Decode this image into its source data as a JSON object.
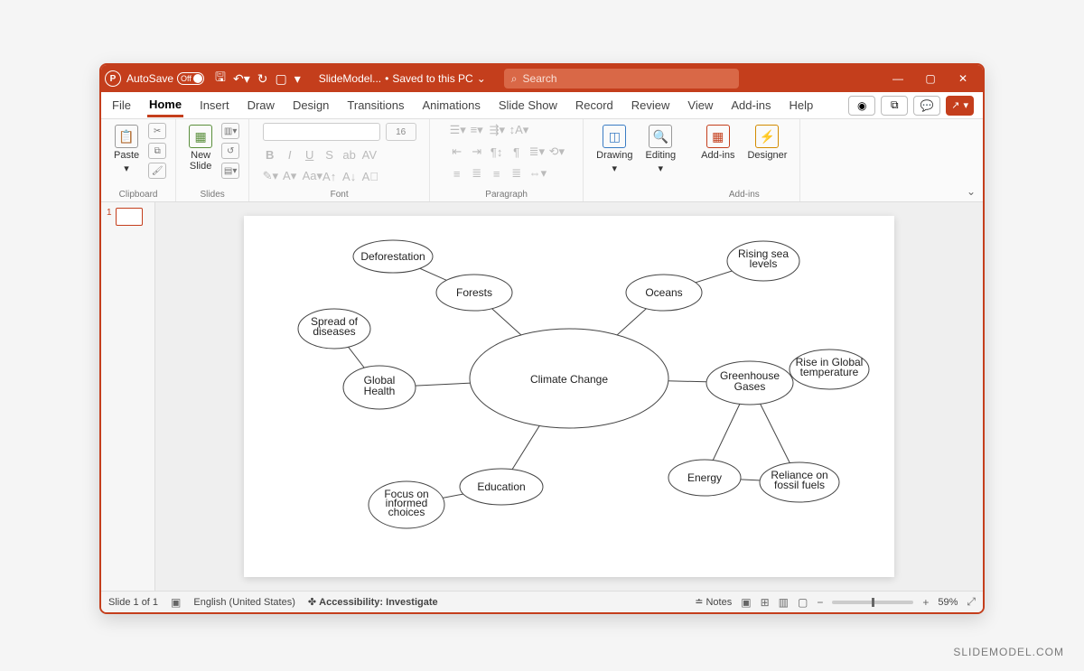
{
  "titlebar": {
    "autosave_label": "AutoSave",
    "autosave_state": "Off",
    "doc_name": "SlideModel...",
    "save_status": "Saved to this PC",
    "search_placeholder": "Search"
  },
  "menu": {
    "tabs": [
      "File",
      "Home",
      "Insert",
      "Draw",
      "Design",
      "Transitions",
      "Animations",
      "Slide Show",
      "Record",
      "Review",
      "View",
      "Add-ins",
      "Help"
    ],
    "active_index": 1
  },
  "ribbon": {
    "clipboard": {
      "paste": "Paste",
      "label": "Clipboard"
    },
    "slides": {
      "new_slide": "New\nSlide",
      "label": "Slides"
    },
    "font": {
      "size": "16",
      "label": "Font",
      "bold": "B",
      "italic": "I",
      "underline": "U",
      "strike": "S",
      "char_spacing": "AV"
    },
    "paragraph": {
      "label": "Paragraph"
    },
    "drawing": {
      "drawing": "Drawing",
      "editing": "Editing"
    },
    "addins": {
      "addins": "Add-ins",
      "designer": "Designer",
      "label": "Add-ins"
    }
  },
  "thumbnails": {
    "slide1_num": "1"
  },
  "mindmap": {
    "center": "Climate Change",
    "nodes": {
      "forests": "Forests",
      "deforestation": "Deforestation",
      "oceans": "Oceans",
      "rising_sea": "Rising sea\nlevels",
      "greenhouse": "Greenhouse\nGases",
      "rise_temp": "Rise in Global\ntemperature",
      "energy": "Energy",
      "fossil": "Reliance on\nfossil fuels",
      "education": "Education",
      "choices": "Focus on\ninformed\nchoices",
      "health": "Global\nHealth",
      "diseases": "Spread of\ndiseases"
    }
  },
  "status": {
    "slide_counter": "Slide 1 of 1",
    "language": "English (United States)",
    "accessibility": "Accessibility: Investigate",
    "notes": "Notes",
    "zoom": "59%"
  },
  "watermark": "SLIDEMODEL.COM"
}
